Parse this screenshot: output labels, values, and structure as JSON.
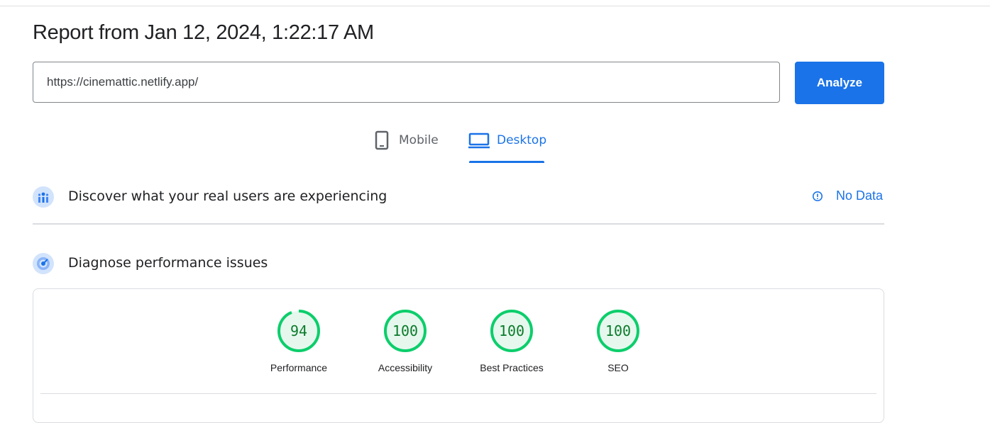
{
  "report": {
    "title": "Report from Jan 12, 2024, 1:22:17 AM"
  },
  "search": {
    "url": "https://cinemattic.netlify.app/",
    "button_label": "Analyze"
  },
  "tabs": [
    {
      "label": "Mobile",
      "icon": "phone-icon",
      "selected": false
    },
    {
      "label": "Desktop",
      "icon": "laptop-icon",
      "selected": true
    }
  ],
  "field_data": {
    "title": "Discover what your real users are experiencing",
    "status": "No Data"
  },
  "lab_data": {
    "title": "Diagnose performance issues",
    "scores": [
      {
        "label": "Performance",
        "score": "94",
        "value": 94
      },
      {
        "label": "Accessibility",
        "score": "100",
        "value": 100
      },
      {
        "label": "Best Practices",
        "score": "100",
        "value": 100
      },
      {
        "label": "SEO",
        "score": "100",
        "value": 100
      }
    ]
  },
  "colors": {
    "accent": "#1a73e8",
    "pass_ring": "#0cce6b",
    "pass_fill": "#e6f8ee",
    "pass_text": "#0b7a2a"
  }
}
